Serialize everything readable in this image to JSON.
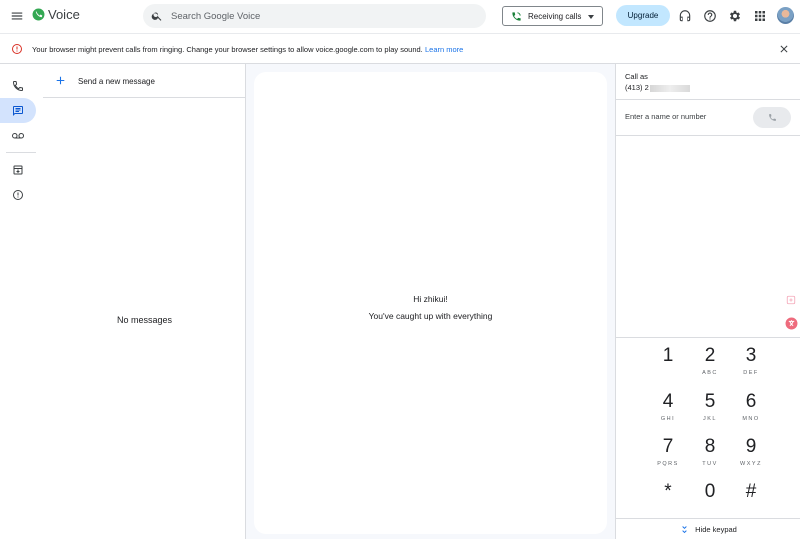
{
  "app": {
    "name": "Voice"
  },
  "search": {
    "placeholder": "Search Google Voice"
  },
  "header": {
    "receiving_label": "Receiving calls",
    "upgrade_label": "Upgrade"
  },
  "banner": {
    "message": "Your browser might prevent calls from ringing. Change your browser settings to allow voice.google.com to play sound.",
    "link": "Learn more"
  },
  "messages": {
    "send_new_label": "Send a new message",
    "empty_label": "No messages"
  },
  "center": {
    "greeting": "Hi zhikui!",
    "status": "You've caught up with everything"
  },
  "dialer": {
    "call_as_label": "Call as",
    "number_prefix": "(413) 2",
    "input_placeholder": "Enter a name or number",
    "keys": [
      {
        "digit": "1",
        "letters": ""
      },
      {
        "digit": "2",
        "letters": "ABC"
      },
      {
        "digit": "3",
        "letters": "DEF"
      },
      {
        "digit": "4",
        "letters": "GHI"
      },
      {
        "digit": "5",
        "letters": "JKL"
      },
      {
        "digit": "6",
        "letters": "MNO"
      },
      {
        "digit": "7",
        "letters": "PQRS"
      },
      {
        "digit": "8",
        "letters": "TUV"
      },
      {
        "digit": "9",
        "letters": "WXYZ"
      },
      {
        "digit": "*",
        "letters": ""
      },
      {
        "digit": "0",
        "letters": ""
      },
      {
        "digit": "#",
        "letters": ""
      }
    ],
    "hide_keypad_label": "Hide keypad"
  },
  "colors": {
    "accent": "#1a73e8",
    "voice_green": "#188038",
    "upgrade_bg": "#c2e7ff",
    "active_nav_bg": "#d3e3fd",
    "warning_red": "#d93025"
  },
  "icons": {
    "menu": "hamburger-menu-icon",
    "search": "search-icon",
    "phone": "phone-icon",
    "support": "headset-icon",
    "help": "help-icon",
    "settings": "gear-icon",
    "apps": "apps-grid-icon",
    "warning": "error-outline-icon",
    "close": "close-icon",
    "messages": "message-icon",
    "voicemail": "voicemail-icon",
    "archive": "archive-icon",
    "spam": "spam-icon",
    "expand": "double-chevron-icon"
  }
}
